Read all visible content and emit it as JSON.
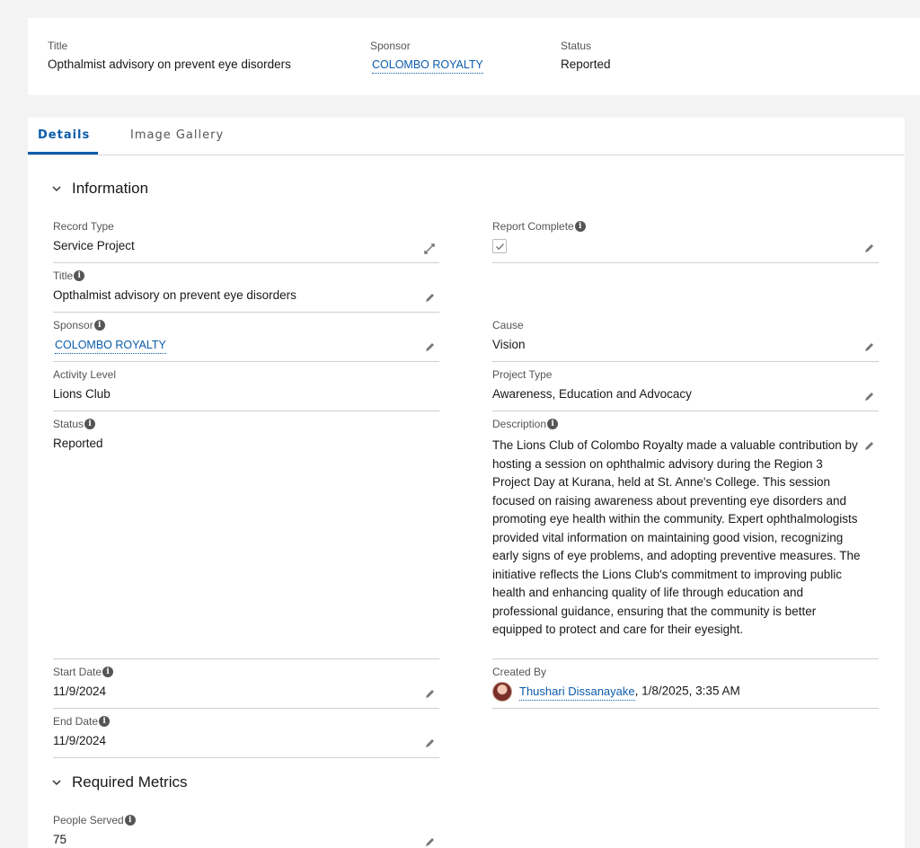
{
  "header": {
    "title_label": "Title",
    "title_value": "Opthalmist advisory on prevent eye disorders",
    "sponsor_label": "Sponsor",
    "sponsor_value": "COLOMBO ROYALTY",
    "status_label": "Status",
    "status_value": "Reported"
  },
  "tabs": {
    "details": "Details",
    "gallery": "Image Gallery"
  },
  "sections": {
    "information": "Information",
    "metrics": "Required Metrics"
  },
  "fields": {
    "record_type": {
      "label": "Record Type",
      "value": "Service Project"
    },
    "report_complete": {
      "label": "Report Complete",
      "checked": true
    },
    "title": {
      "label": "Title",
      "value": "Opthalmist advisory on prevent eye disorders"
    },
    "sponsor": {
      "label": "Sponsor",
      "value": "COLOMBO ROYALTY"
    },
    "cause": {
      "label": "Cause",
      "value": "Vision"
    },
    "activity_level": {
      "label": "Activity Level",
      "value": "Lions Club"
    },
    "project_type": {
      "label": "Project Type",
      "value": "Awareness, Education and Advocacy"
    },
    "status": {
      "label": "Status",
      "value": "Reported"
    },
    "description": {
      "label": "Description",
      "value": "The Lions Club of Colombo Royalty made a valuable contribution by hosting a session on ophthalmic advisory during the Region 3 Project Day at Kurana, held at St. Anne's College. This session focused on raising awareness about preventing eye disorders and promoting eye health within the community. Expert ophthalmologists provided vital information on maintaining good vision, recognizing early signs of eye problems, and adopting preventive measures. The initiative reflects the Lions Club's commitment to improving public health and enhancing quality of life through education and professional guidance, ensuring that the community is better equipped to protect and care for their eyesight."
    },
    "start_date": {
      "label": "Start Date",
      "value": "11/9/2024"
    },
    "end_date": {
      "label": "End Date",
      "value": "11/9/2024"
    },
    "created_by": {
      "label": "Created By",
      "user": "Thushari Dissanayake",
      "timestamp": ", 1/8/2025, 3:35 AM"
    },
    "people_served": {
      "label": "People Served",
      "value": "75"
    }
  },
  "icons": {
    "edit": "pencil-icon",
    "change_record_type": "swap-icon",
    "info": "info-icon",
    "chevron": "chevron-down-icon"
  },
  "colors": {
    "accent": "#0b5cab",
    "background": "#f3f3f3"
  }
}
